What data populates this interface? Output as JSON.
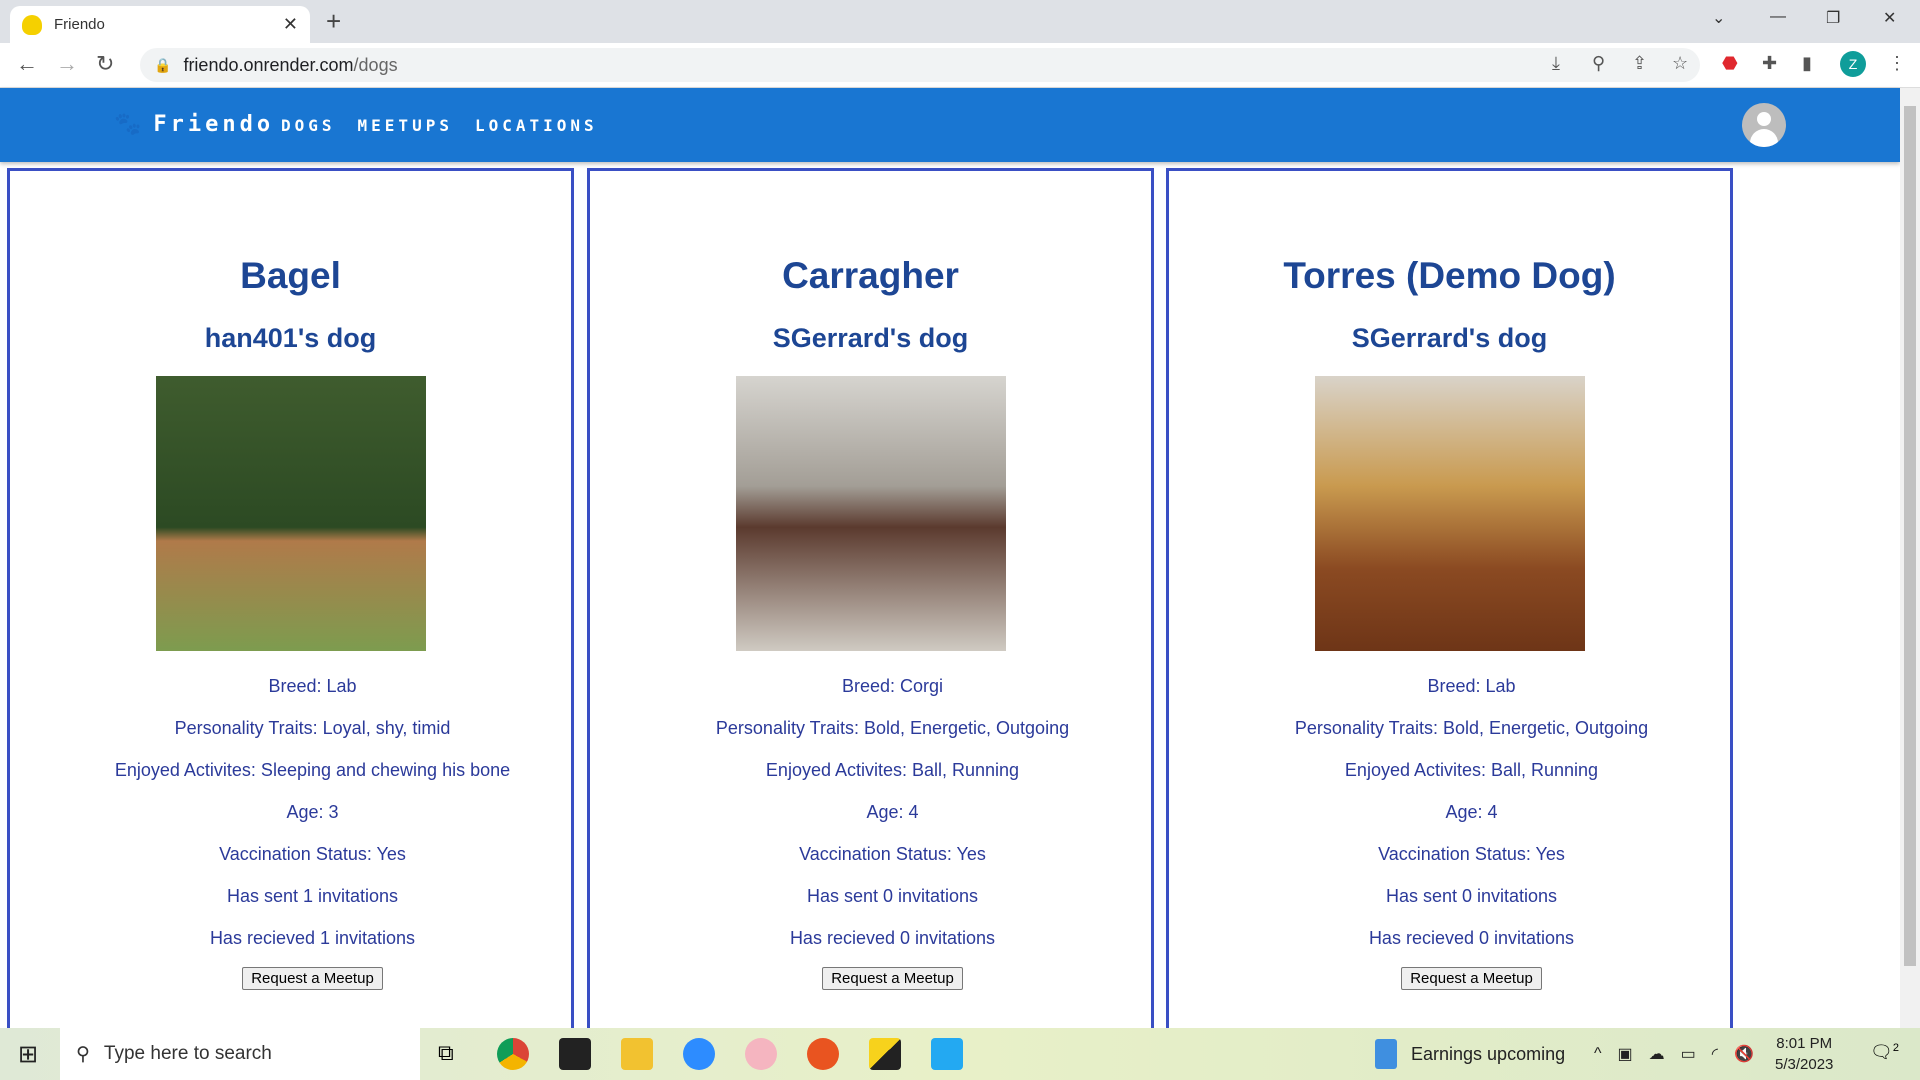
{
  "browser": {
    "tab_title": "Friendo",
    "url_host": "friendo.onrender.com",
    "url_path": "/dogs",
    "profile_initial": "Z"
  },
  "nav": {
    "brand": "Friendo",
    "links": [
      "DOGS",
      "MEETUPS",
      "LOCATIONS"
    ]
  },
  "dogs": [
    {
      "name": "Bagel",
      "owner": "han401's dog",
      "breed": "Breed: Lab",
      "traits": "Personality Traits: Loyal, shy, timid",
      "activities": "Enjoyed Activites: Sleeping and chewing his bone",
      "age": "Age: 3",
      "vaccination": "Vaccination Status: Yes",
      "sent": "Has sent 1 invitations",
      "received": "Has recieved 1 invitations",
      "button": "Request a Meetup"
    },
    {
      "name": "Carragher",
      "owner": "SGerrard's dog",
      "breed": "Breed: Corgi",
      "traits": "Personality Traits: Bold, Energetic, Outgoing",
      "activities": "Enjoyed Activites: Ball, Running",
      "age": "Age: 4",
      "vaccination": "Vaccination Status: Yes",
      "sent": "Has sent 0 invitations",
      "received": "Has recieved 0 invitations",
      "button": "Request a Meetup"
    },
    {
      "name": "Torres (Demo Dog)",
      "owner": "SGerrard's dog",
      "breed": "Breed: Lab",
      "traits": "Personality Traits: Bold, Energetic, Outgoing",
      "activities": "Enjoyed Activites: Ball, Running",
      "age": "Age: 4",
      "vaccination": "Vaccination Status: Yes",
      "sent": "Has sent 0 invitations",
      "received": "Has recieved 0 invitations",
      "button": "Request a Meetup"
    }
  ],
  "taskbar": {
    "search_placeholder": "Type here to search",
    "news": "Earnings upcoming",
    "time": "8:01 PM",
    "date": "5/3/2023",
    "notifications": "2"
  },
  "colors": {
    "nav": "#1976d2",
    "card_border": "#3a4fc4",
    "title": "#1d4694"
  }
}
